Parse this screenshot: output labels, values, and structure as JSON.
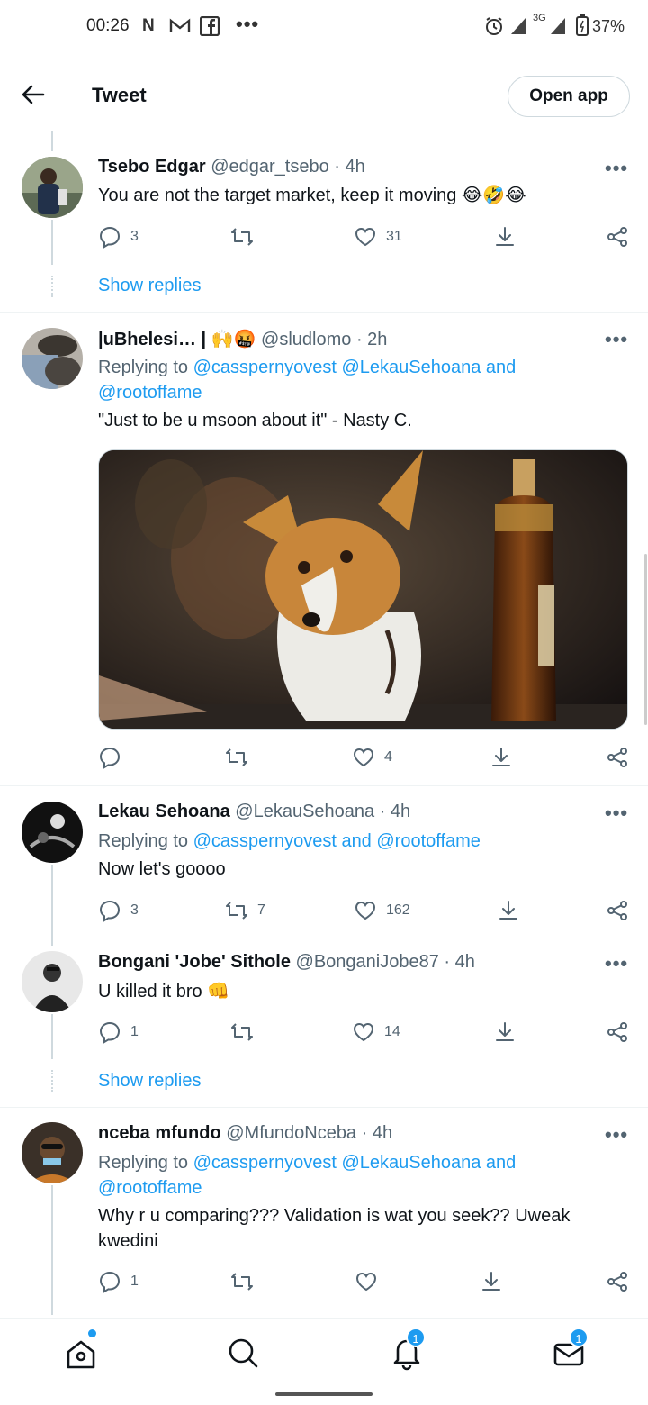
{
  "status_bar": {
    "time": "00:26",
    "battery": "37%",
    "network": "3G"
  },
  "header": {
    "title": "Tweet",
    "open_app": "Open app"
  },
  "tweets": [
    {
      "name": "Tsebo Edgar",
      "handle": "@edgar_tsebo",
      "time": "· 4h",
      "text": "You are not the target market, keep it moving 😂🤣😂",
      "replies": "3",
      "retweets": "",
      "likes": "31",
      "show_replies": "Show replies"
    },
    {
      "name": "|uBhelesi… | 🙌🤬",
      "handle": "@sludlomo",
      "time": "· 2h",
      "replying_prefix": "Replying to",
      "replying_mentions": "@casspernyovest @LekauSehoana and @rootoffame",
      "text": "\"Just to be u msoon about it\" - Nasty C.",
      "replies": "",
      "retweets": "",
      "likes": "4"
    },
    {
      "name": "Lekau Sehoana",
      "handle": "@LekauSehoana",
      "time": "· 4h",
      "replying_prefix": "Replying to",
      "replying_mentions": "@casspernyovest and @rootoffame",
      "text": "Now let's goooo",
      "replies": "3",
      "retweets": "7",
      "likes": "162"
    },
    {
      "name": "Bongani 'Jobe' Sithole",
      "handle": "@BonganiJobe87",
      "time": "· 4h",
      "text": "U killed it bro 👊",
      "replies": "1",
      "retweets": "",
      "likes": "14",
      "show_replies": "Show replies"
    },
    {
      "name": "nceba mfundo",
      "handle": "@MfundoNceba",
      "time": "· 4h",
      "replying_prefix": "Replying to",
      "replying_mentions": "@casspernyovest @LekauSehoana and @rootoffame",
      "text": "Why r u comparing??? Validation is wat you seek?? Uweak kwedini",
      "replies": "1",
      "retweets": "",
      "likes": ""
    }
  ],
  "bottom_nav": {
    "notifications_badge": "1",
    "messages_badge": "1"
  },
  "colors": {
    "accent": "#1d9bf0",
    "text": "#0f1419",
    "muted": "#536471",
    "border": "#cfd9de"
  }
}
